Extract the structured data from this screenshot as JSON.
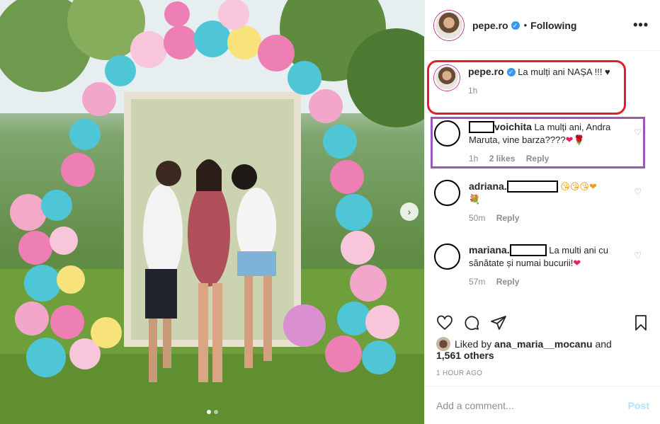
{
  "header": {
    "username": "pepe.ro",
    "separator": "•",
    "follow_status": "Following",
    "more": "•••"
  },
  "caption": {
    "username": "pepe.ro",
    "text": "La mulți ani NAȘA !!! ♥",
    "time": "1h"
  },
  "comments": [
    {
      "username": "voichita",
      "text": "La mulți ani, Andra Maruta, vine barza????",
      "emoji": "❤🌹",
      "time": "1h",
      "likes": "2 likes",
      "reply": "Reply"
    },
    {
      "username": "adriana.",
      "text": "",
      "emoji": "😘😘😘❤",
      "emoji2": "💐",
      "time": "50m",
      "reply": "Reply"
    },
    {
      "username": "mariana.",
      "text": "La multi ani cu sănătate și numai bucurii!",
      "emoji": "❤",
      "time": "57m",
      "reply": "Reply"
    }
  ],
  "likes": {
    "prefix": "Liked by",
    "liker": "ana_maria__mocanu",
    "and": "and",
    "others": "1,561 others"
  },
  "timestamp": "1 HOUR AGO",
  "add_comment": {
    "placeholder": "Add a comment...",
    "post": "Post"
  },
  "carousel": {
    "dots": 2,
    "active": 0
  },
  "colors": {
    "caption_box": "#e01e2e",
    "comment_box": "#9b59b6",
    "verified": "#3897f0",
    "post_disabled": "#b2dffc"
  }
}
